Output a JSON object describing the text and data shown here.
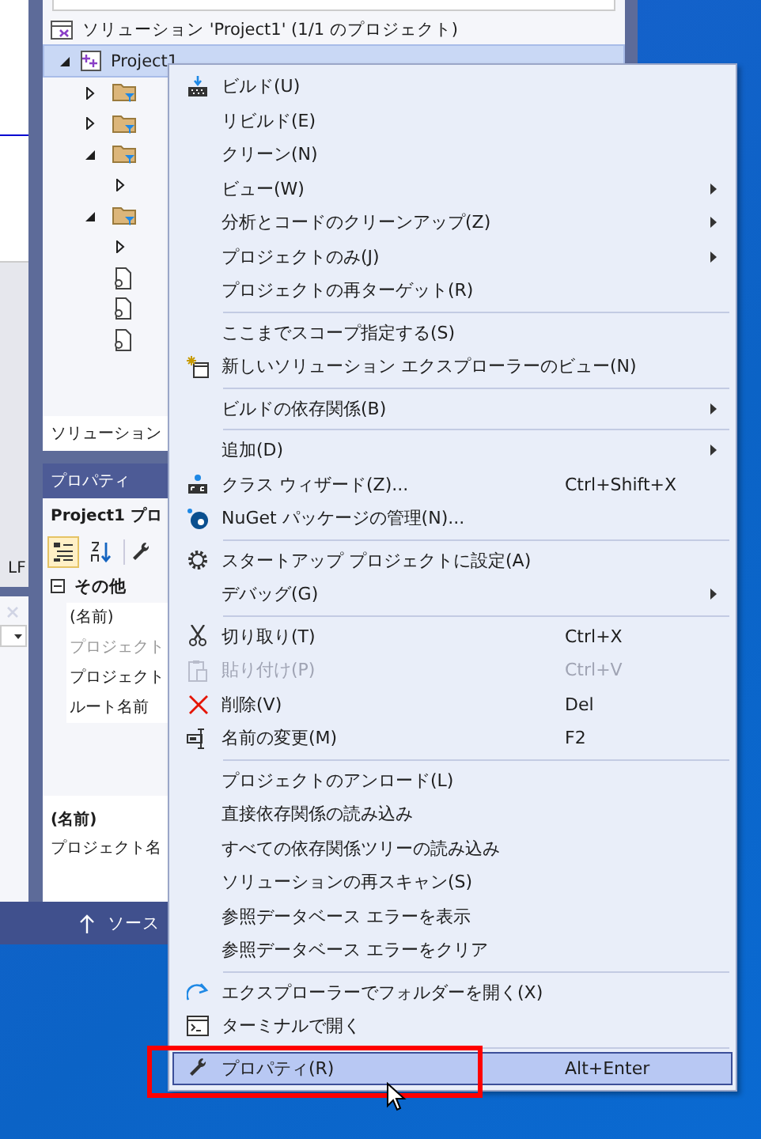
{
  "editor": {
    "line_ending": "LF"
  },
  "solution_explorer": {
    "tree": [
      {
        "label": "ソリューション 'Project1' (1/1 のプロジェクト)",
        "children": [
          {
            "label": "Project1",
            "expanded": true,
            "selected": true,
            "children": [
              {
                "kind": "folder",
                "expanded": false
              },
              {
                "kind": "folder",
                "expanded": false
              },
              {
                "kind": "folder",
                "expanded": true,
                "children": [
                  {
                    "expanded": false
                  }
                ]
              },
              {
                "kind": "folder",
                "expanded": true,
                "children": [
                  {
                    "expanded": false
                  }
                ]
              },
              {
                "kind": "file"
              },
              {
                "kind": "file"
              },
              {
                "kind": "file"
              }
            ]
          }
        ]
      }
    ],
    "tab_label": "ソリューション"
  },
  "properties": {
    "title": "プロパティ",
    "header": "Project1 プロ",
    "categorized_selected": true,
    "category": {
      "label": "その他",
      "expanded": true
    },
    "rows": [
      {
        "label": "(名前)",
        "disabled": false
      },
      {
        "label": "プロジェクト",
        "disabled": true
      },
      {
        "label": "プロジェクト",
        "disabled": false
      },
      {
        "label": "ルート名前",
        "disabled": false
      }
    ],
    "description": {
      "title": "(名前)",
      "text": "プロジェクト名"
    }
  },
  "status_bar": {
    "text": "ソース"
  },
  "context_menu": {
    "items": [
      {
        "kind": "item",
        "label": "ビルド(U)",
        "submenu": false,
        "disabled": false,
        "selected": false,
        "outlined": false
      },
      {
        "kind": "item",
        "label": "リビルド(E)",
        "submenu": false,
        "disabled": false,
        "selected": false,
        "outlined": false
      },
      {
        "kind": "item",
        "label": "クリーン(N)",
        "submenu": false,
        "disabled": false,
        "selected": false,
        "outlined": false
      },
      {
        "kind": "item",
        "label": "ビュー(W)",
        "submenu": true,
        "disabled": false,
        "selected": false,
        "outlined": false
      },
      {
        "kind": "item",
        "label": "分析とコードのクリーンアップ(Z)",
        "submenu": true,
        "disabled": false,
        "selected": false,
        "outlined": false
      },
      {
        "kind": "item",
        "label": "プロジェクトのみ(J)",
        "submenu": true,
        "disabled": false,
        "selected": false,
        "outlined": false
      },
      {
        "kind": "item",
        "label": "プロジェクトの再ターゲット(R)",
        "submenu": false,
        "disabled": false,
        "selected": false,
        "outlined": false
      },
      {
        "kind": "separator"
      },
      {
        "kind": "item",
        "label": "ここまでスコープ指定する(S)",
        "submenu": false,
        "disabled": false,
        "selected": false,
        "outlined": false
      },
      {
        "kind": "item",
        "label": "新しいソリューション エクスプローラーのビュー(N)",
        "submenu": false,
        "disabled": false,
        "selected": false,
        "outlined": false
      },
      {
        "kind": "separator"
      },
      {
        "kind": "item",
        "label": "ビルドの依存関係(B)",
        "submenu": true,
        "disabled": false,
        "selected": false,
        "outlined": false
      },
      {
        "kind": "separator"
      },
      {
        "kind": "item",
        "label": "追加(D)",
        "submenu": true,
        "disabled": false,
        "selected": false,
        "outlined": false
      },
      {
        "kind": "item",
        "label": "クラス ウィザード(Z)...",
        "shortcut": "Ctrl+Shift+X",
        "submenu": false,
        "disabled": false,
        "selected": false,
        "outlined": false
      },
      {
        "kind": "item",
        "label": "NuGet パッケージの管理(N)...",
        "submenu": false,
        "disabled": false,
        "selected": false,
        "outlined": false
      },
      {
        "kind": "separator"
      },
      {
        "kind": "item",
        "label": "スタートアップ プロジェクトに設定(A)",
        "submenu": false,
        "disabled": false,
        "selected": false,
        "outlined": false
      },
      {
        "kind": "item",
        "label": "デバッグ(G)",
        "submenu": true,
        "disabled": false,
        "selected": false,
        "outlined": false
      },
      {
        "kind": "separator"
      },
      {
        "kind": "item",
        "label": "切り取り(T)",
        "shortcut": "Ctrl+X",
        "submenu": false,
        "disabled": false,
        "selected": false,
        "outlined": false
      },
      {
        "kind": "item",
        "label": "貼り付け(P)",
        "shortcut": "Ctrl+V",
        "submenu": false,
        "disabled": true,
        "selected": false,
        "outlined": false
      },
      {
        "kind": "item",
        "label": "削除(V)",
        "shortcut": "Del",
        "submenu": false,
        "disabled": false,
        "selected": false,
        "outlined": false
      },
      {
        "kind": "item",
        "label": "名前の変更(M)",
        "shortcut": "F2",
        "submenu": false,
        "disabled": false,
        "selected": false,
        "outlined": false
      },
      {
        "kind": "separator"
      },
      {
        "kind": "item",
        "label": "プロジェクトのアンロード(L)",
        "submenu": false,
        "disabled": false,
        "selected": false,
        "outlined": false
      },
      {
        "kind": "item",
        "label": "直接依存関係の読み込み",
        "submenu": false,
        "disabled": false,
        "selected": false,
        "outlined": false
      },
      {
        "kind": "item",
        "label": "すべての依存関係ツリーの読み込み",
        "submenu": false,
        "disabled": false,
        "selected": false,
        "outlined": false
      },
      {
        "kind": "item",
        "label": "ソリューションの再スキャン(S)",
        "submenu": false,
        "disabled": false,
        "selected": false,
        "outlined": false
      },
      {
        "kind": "item",
        "label": "参照データベース エラーを表示",
        "submenu": false,
        "disabled": false,
        "selected": false,
        "outlined": false
      },
      {
        "kind": "item",
        "label": "参照データベース エラーをクリア",
        "submenu": false,
        "disabled": false,
        "selected": false,
        "outlined": false
      },
      {
        "kind": "separator"
      },
      {
        "kind": "item",
        "label": "エクスプローラーでフォルダーを開く(X)",
        "submenu": false,
        "disabled": false,
        "selected": false,
        "outlined": false
      },
      {
        "kind": "item",
        "label": "ターミナルで開く",
        "submenu": false,
        "disabled": false,
        "selected": false,
        "outlined": false
      },
      {
        "kind": "separator"
      },
      {
        "kind": "item",
        "label": "プロパティ(R)",
        "shortcut": "Alt+Enter",
        "submenu": false,
        "disabled": false,
        "selected": true,
        "outlined": true
      }
    ]
  }
}
